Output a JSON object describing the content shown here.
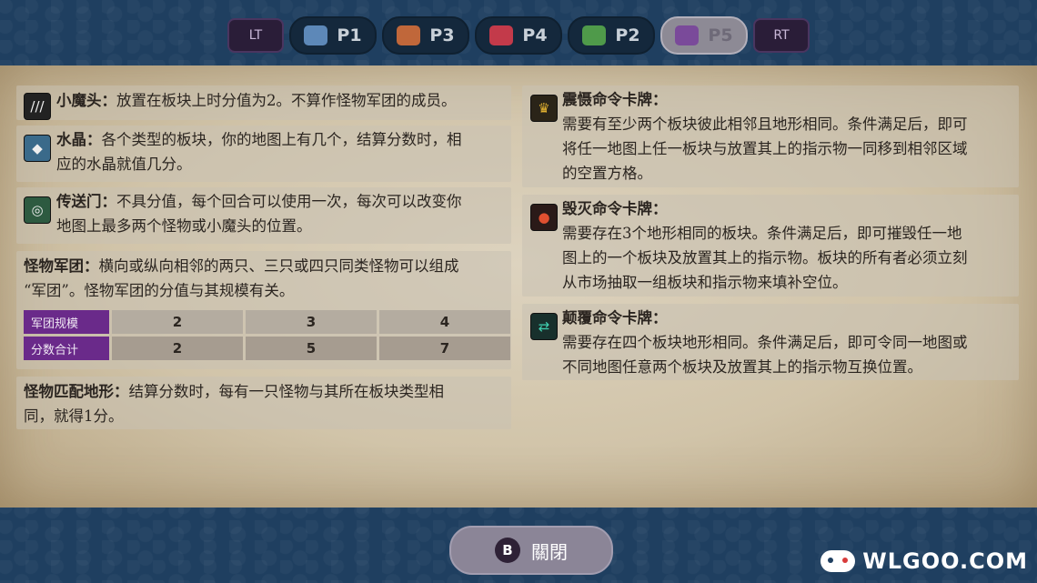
{
  "topbar": {
    "lt": "LT",
    "rt": "RT",
    "tabs": [
      {
        "label": "P1",
        "color": "#5d88b8"
      },
      {
        "label": "P3",
        "color": "#c0673a"
      },
      {
        "label": "P4",
        "color": "#c33a4a"
      },
      {
        "label": "P2",
        "color": "#4f9a4a"
      },
      {
        "label": "P5",
        "color": "#7a4a9a",
        "active": true
      }
    ]
  },
  "left": {
    "imp": {
      "title": "小魔头：",
      "text": "放置在板块上时分值为2。不算作怪物军团的成员。"
    },
    "crystal": {
      "title": "水晶：",
      "text": "各个类型的板块，你的地图上有几个，结算分数时，相",
      "text2": "应的水晶就值几分。"
    },
    "portal": {
      "title": "传送门：",
      "text": "不具分值，每个回合可以使用一次，每次可以改变你",
      "text2": "地图上最多两个怪物或小魔头的位置。"
    },
    "legion": {
      "title": "怪物军团：",
      "text": "横向或纵向相邻的两只、三只或四只同类怪物可以组成",
      "text2": "“军团”。怪物军团的分值与其规模有关。"
    },
    "table": {
      "row1_head": "军团规模",
      "row1": [
        "2",
        "3",
        "4"
      ],
      "row2_head": "分数合计",
      "row2": [
        "2",
        "5",
        "7"
      ]
    },
    "terrain": {
      "title": "怪物匹配地形：",
      "text": "结算分数时，每有一只怪物与其所在板块类型相",
      "text2": "同，就得1分。"
    }
  },
  "right": {
    "awe": {
      "title": "震慑命令卡牌：",
      "l1": "需要有至少两个板块彼此相邻且地形相同。条件满足后，即可",
      "l2": "将任一地图上任一板块与放置其上的指示物一同移到相邻区域",
      "l3": "的空置方格。"
    },
    "destroy": {
      "title": "毁灭命令卡牌：",
      "l1": "需要存在3个地形相同的板块。条件满足后，即可摧毁任一地",
      "l2": "图上的一个板块及放置其上的指示物。板块的所有者必须立刻",
      "l3": "从市场抽取一组板块和指示物来填补空位。"
    },
    "subvert": {
      "title": "颠覆命令卡牌：",
      "l1": "需要存在四个板块地形相同。条件满足后，即可令同一地图或",
      "l2": "不同地图任意两个板块及放置其上的指示物互换位置。"
    }
  },
  "close": {
    "badge": "B",
    "label": "關閉"
  },
  "watermark": "WLGOO.COM"
}
